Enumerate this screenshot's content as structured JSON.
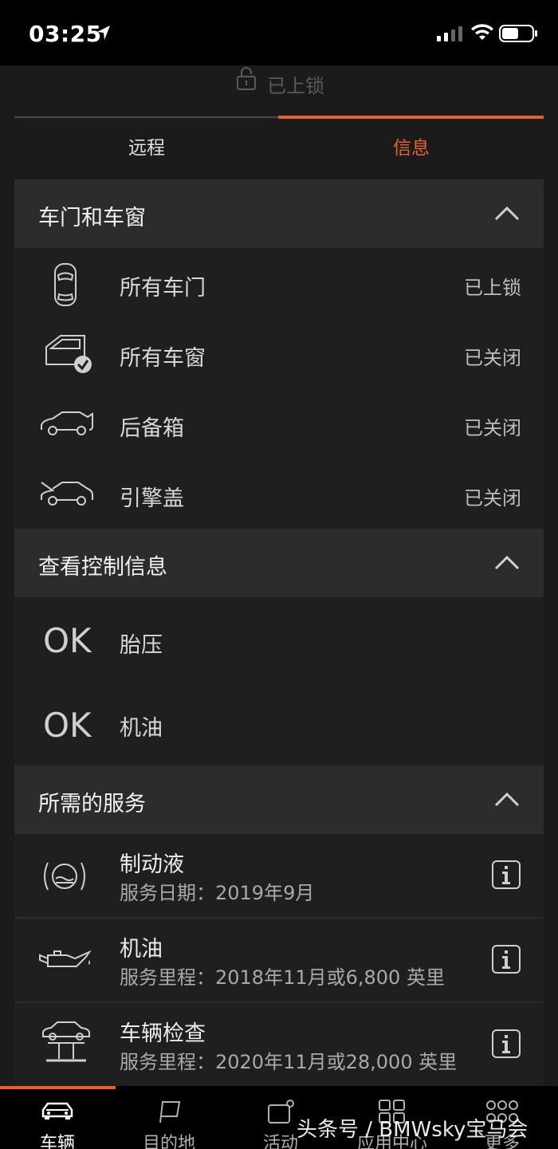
{
  "status_bar": {
    "time": "03:25"
  },
  "lock_status": {
    "text": "已上锁"
  },
  "tabs": [
    {
      "label": "远程",
      "active": false
    },
    {
      "label": "信息",
      "active": true
    }
  ],
  "sections": {
    "doors": {
      "title": "车门和车窗",
      "rows": [
        {
          "label": "所有车门",
          "value": "已上锁",
          "icon": "car-top-view-icon"
        },
        {
          "label": "所有车窗",
          "value": "已关闭",
          "icon": "window-check-icon"
        },
        {
          "label": "后备箱",
          "value": "已关闭",
          "icon": "trunk-icon"
        },
        {
          "label": "引擎盖",
          "value": "已关闭",
          "icon": "hood-icon"
        }
      ]
    },
    "checks": {
      "title": "查看控制信息",
      "rows": [
        {
          "status": "OK",
          "label": "胎压"
        },
        {
          "status": "OK",
          "label": "机油"
        }
      ]
    },
    "services": {
      "title": "所需的服务",
      "rows": [
        {
          "title": "制动液",
          "subtitle": "服务日期：2019年9月",
          "icon": "brake-fluid-icon"
        },
        {
          "title": "机油",
          "subtitle": "服务里程：2018年11月或6,800 英里",
          "icon": "oil-can-icon"
        },
        {
          "title": "车辆检查",
          "subtitle": "服务里程：2020年11月或28,000 英里",
          "icon": "car-lift-icon"
        }
      ]
    }
  },
  "bottom_nav": [
    {
      "label": "车辆",
      "icon": "car-icon",
      "active": true
    },
    {
      "label": "目的地",
      "icon": "flag-icon",
      "active": false
    },
    {
      "label": "活动",
      "icon": "activity-icon",
      "active": false
    },
    {
      "label": "应用中心",
      "icon": "apps-grid-icon",
      "active": false
    },
    {
      "label": "更多",
      "icon": "more-dots-icon",
      "active": false
    }
  ],
  "watermark": "头条号 / BMWsky宝马会",
  "colors": {
    "accent": "#e8612c",
    "background": "#1b1b1b",
    "header": "#2c2c2c"
  }
}
